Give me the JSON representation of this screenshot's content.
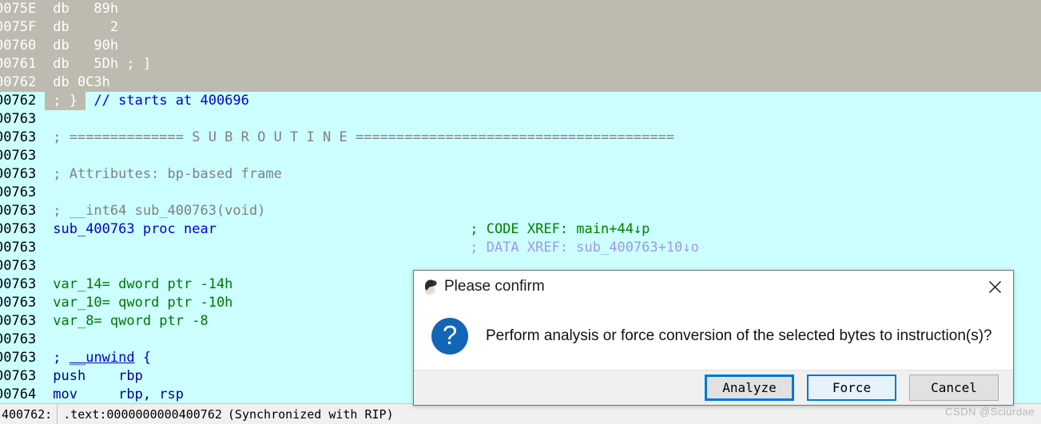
{
  "app": {
    "name": "IDA Pro disassembly view"
  },
  "listing": {
    "lines": [
      {
        "addr": "0075E",
        "selected": true,
        "segments": [
          {
            "t": "db   89h",
            "c": "white"
          }
        ]
      },
      {
        "addr": "0075F",
        "selected": true,
        "segments": [
          {
            "t": "db     2",
            "c": "white"
          }
        ]
      },
      {
        "addr": "00760",
        "selected": true,
        "segments": [
          {
            "t": "db   90h",
            "c": "white"
          }
        ]
      },
      {
        "addr": "00761",
        "selected": true,
        "segments": [
          {
            "t": "db   5Dh ; ]",
            "c": "white"
          }
        ]
      },
      {
        "addr": "00762",
        "selected": true,
        "segments": [
          {
            "t": "db 0C3h",
            "c": "white"
          }
        ]
      },
      {
        "addr": "00762",
        "selected": "partial",
        "selected_text": "; }",
        "segments": [
          {
            "t": "// starts at 400696",
            "c": "blue"
          }
        ]
      },
      {
        "addr": "00763",
        "selected": false,
        "segments": []
      },
      {
        "addr": "00763",
        "selected": false,
        "segments": [
          {
            "t": "; ============== S U B R O U T I N E =======================================",
            "c": "gray"
          }
        ]
      },
      {
        "addr": "00763",
        "selected": false,
        "segments": []
      },
      {
        "addr": "00763",
        "selected": false,
        "segments": [
          {
            "t": "; Attributes: bp-based frame",
            "c": "gray"
          }
        ]
      },
      {
        "addr": "00763",
        "selected": false,
        "segments": []
      },
      {
        "addr": "00763",
        "selected": false,
        "segments": [
          {
            "t": "; __int64 sub_400763(void)",
            "c": "gray"
          }
        ]
      },
      {
        "addr": "00763",
        "selected": false,
        "segments": [
          {
            "t": "sub_400763 proc near",
            "c": "blue"
          }
        ],
        "comment": {
          "label": "; CODE XREF: ",
          "target": "main+44↓p",
          "kind": "code"
        }
      },
      {
        "addr": "00763",
        "selected": false,
        "segments": [],
        "comment": {
          "label": "; DATA XREF: ",
          "target": "sub_400763+10↓o",
          "kind": "data"
        }
      },
      {
        "addr": "00763",
        "selected": false,
        "segments": []
      },
      {
        "addr": "00763",
        "selected": false,
        "segments": [
          {
            "t": "var_14= dword ptr -14h",
            "c": "dgreen"
          }
        ]
      },
      {
        "addr": "00763",
        "selected": false,
        "segments": [
          {
            "t": "var_10= qword ptr -10h",
            "c": "dgreen"
          }
        ]
      },
      {
        "addr": "00763",
        "selected": false,
        "segments": [
          {
            "t": "var_8= qword ptr -8",
            "c": "dgreen"
          }
        ]
      },
      {
        "addr": "00763",
        "selected": false,
        "segments": []
      },
      {
        "addr": "00763",
        "selected": false,
        "segments": [
          {
            "t": "; __unwind {",
            "c": "blue",
            "underline_part": "__unwind"
          }
        ]
      },
      {
        "addr": "00763",
        "selected": false,
        "segments": [
          {
            "t": "push    rbp",
            "c": "navy"
          }
        ]
      },
      {
        "addr": "00764",
        "selected": false,
        "segments": [
          {
            "t": "mov     rbp, rsp",
            "c": "navy"
          }
        ]
      }
    ],
    "xref_code_label": "; CODE XREF: ",
    "xref_code_target": "main+44↓p",
    "xref_data_label": "; DATA XREF: ",
    "xref_data_target": "sub_400763+10↓o"
  },
  "statusbar": {
    "position": "400762:",
    "segment_address": ".text:0000000000400762",
    "sync_note": "(Synchronized with RIP)"
  },
  "watermark": {
    "text": "CSDN @Sciurdae"
  },
  "dialog": {
    "icon_name": "ida-logo-icon",
    "title": "Please confirm",
    "close_label": "×",
    "question_icon_glyph": "?",
    "message": "Perform analysis or force conversion of the selected bytes to instruction(s)?",
    "buttons": [
      {
        "label": "Analyze",
        "state": "default"
      },
      {
        "label": "Force",
        "state": "hover"
      },
      {
        "label": "Cancel",
        "state": "normal"
      }
    ]
  },
  "colors": {
    "selection_gray": "#bdbaaf",
    "listing_background": "#ccffff",
    "accent_blue": "#0078d7",
    "question_icon_blue": "#1266b5",
    "code_xref_green": "#008000",
    "data_xref_lilac": "#9a9ae6",
    "keyword_blue": "#0000cc",
    "comment_gray": "#808080",
    "var_green": "#007700"
  }
}
